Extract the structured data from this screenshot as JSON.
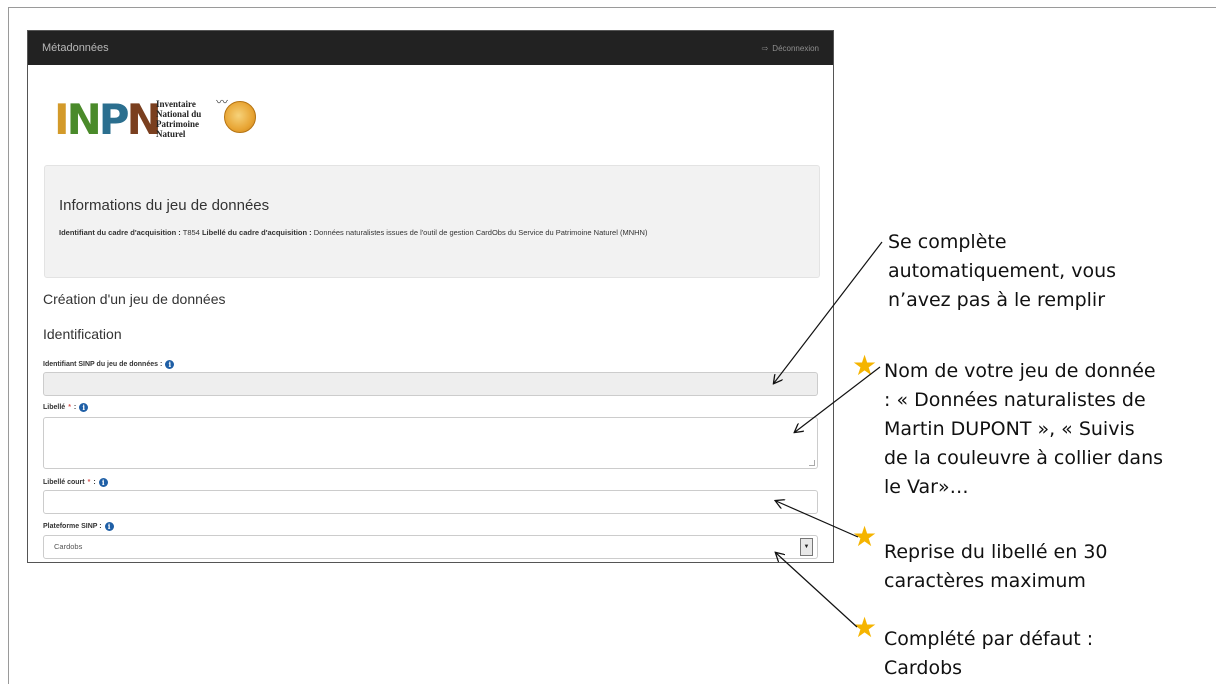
{
  "navbar": {
    "brand": "Métadonnées",
    "logout_label": "Déconnexion",
    "logout_icon": "sign-out-icon"
  },
  "logo": {
    "acronym_letters": [
      "I",
      "N",
      "P",
      "N"
    ],
    "text_lines": [
      "Inventaire",
      "National du",
      "Patrimoine",
      "Naturel"
    ]
  },
  "info_panel": {
    "title": "Informations du jeu de données",
    "id_label": "Identifiant du cadre d'acquisition :",
    "id_value": "T854",
    "libelle_label": "Libellé du cadre d'acquisition :",
    "libelle_value": "Données naturalistes issues de l'outil de gestion CardObs du Service du Patrimoine Naturel (MNHN)"
  },
  "form": {
    "heading": "Création d'un jeu de données",
    "section": "Identification",
    "fields": [
      {
        "label": "Identifiant SINP du jeu de données :",
        "required": false,
        "value": ""
      },
      {
        "label": "Libellé",
        "required": true,
        "value": ""
      },
      {
        "label": "Libellé court",
        "required": true,
        "value": ""
      },
      {
        "label": "Plateforme SINP :",
        "required": false,
        "value": "Cardobs"
      }
    ],
    "required_mark": "*",
    "colon_suffix": " :",
    "info_icon_glyph": "i"
  },
  "annotations": [
    "Se complète automatiquement, vous n’avez pas à le remplir",
    "Nom de votre jeu de donnée : « Données naturalistes de Martin DUPONT », « Suivis de la couleuvre à collier dans le Var»…",
    "Reprise du libellé en 30 caractères maximum",
    "Complété par défaut : Cardobs"
  ],
  "annotation_lines": [
    [
      "Se complète",
      "automatiquement, vous",
      "n’avez pas à le remplir"
    ],
    [
      "Nom de votre jeu de donnée",
      " :  « Données naturalistes de",
      "Martin DUPONT », « Suivis",
      "de la couleuvre à collier dans",
      "le Var»…"
    ],
    [
      "Reprise du libellé en 30",
      "caractères maximum"
    ],
    [
      "Complété par défaut :",
      "Cardobs"
    ]
  ],
  "colors": {
    "navbar": "#222222",
    "star": "#f5b400",
    "info_icon": "#1f5fa6",
    "required": "#d9534f"
  }
}
